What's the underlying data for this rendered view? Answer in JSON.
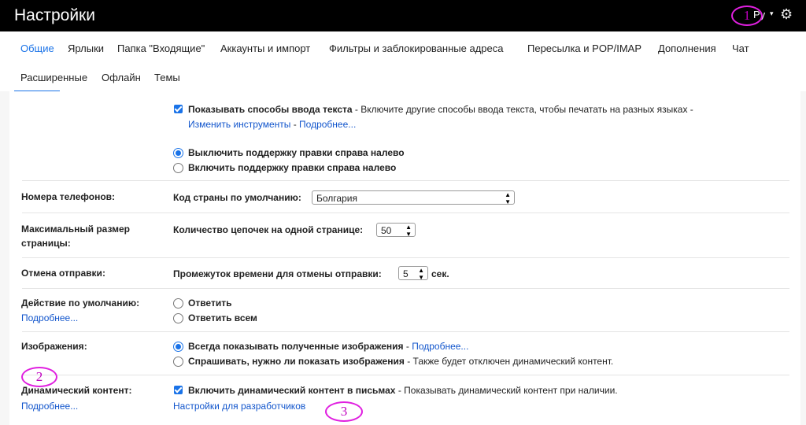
{
  "header": {
    "title": "Настройки",
    "lang_label": "Ру",
    "caret": "▾",
    "gear": "gear-icon"
  },
  "tabs": [
    {
      "label": "Общие"
    },
    {
      "label": "Ярлыки"
    },
    {
      "label": "Папка \"Входящие\""
    },
    {
      "label": "Аккаунты и импорт"
    },
    {
      "label": "Фильтры и заблокированные адреса"
    },
    {
      "label": "Пересылка и POP/IMAP"
    },
    {
      "label": "Дополнения"
    },
    {
      "label": "Чат"
    },
    {
      "label": "Расширенные"
    },
    {
      "label": "Офлайн"
    },
    {
      "label": "Темы"
    }
  ],
  "input_tools": {
    "checkbox_label": "Показывать способы ввода текста",
    "description": " - Включите другие способы ввода текста, чтобы печатать на разных языках -",
    "change_tools_link": "Изменить инструменты",
    "separator": " - ",
    "more_link": "Подробнее..."
  },
  "rtl": {
    "option_off": "Выключить поддержку правки справа налево",
    "option_on": "Включить поддержку правки справа налево"
  },
  "phone": {
    "label": "Номера телефонов:",
    "field_label": "Код страны по умолчанию:",
    "value": "Болгария"
  },
  "page_size": {
    "label_line1": "Максимальный размер",
    "label_line2": "страницы:",
    "field_label": "Количество цепочек на одной странице:",
    "value": "50"
  },
  "undo_send": {
    "label": "Отмена отправки:",
    "field_label": "Промежуток времени для отмены отправки:",
    "value": "5",
    "unit": "сек."
  },
  "default_reply": {
    "label": "Действие по умолчанию:",
    "more_link": "Подробнее...",
    "option_reply": "Ответить",
    "option_reply_all": "Ответить всем"
  },
  "images": {
    "label": "Изображения:",
    "option_always": "Всегда показывать полученные изображения",
    "separator": " - ",
    "more_link": "Подробнее...",
    "option_ask": "Спрашивать, нужно ли показать изображения",
    "ask_note": " - Также будет отключен динамический контент."
  },
  "dynamic": {
    "label": "Динамический контент:",
    "more_link": "Подробнее...",
    "checkbox_label": "Включить динамический контент в письмах",
    "description": " - Показывать динамический контент при наличии.",
    "dev_link": "Настройки для разработчиков"
  },
  "annotations": [
    "1",
    "2",
    "3"
  ],
  "colors": {
    "accent": "#1a73e8",
    "link": "#1155cc",
    "annotation": "#e020e0",
    "topbar": "#000000"
  }
}
